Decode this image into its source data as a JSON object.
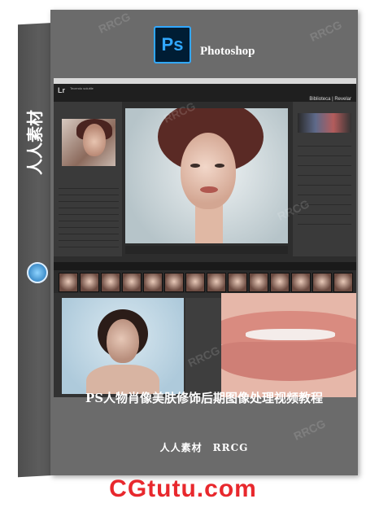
{
  "product": {
    "app_name": "Photoshop",
    "app_icon_text": "Ps",
    "spine_text": "人人素材",
    "title": "PS人物肖像美肤修饰后期图像处理视频教程",
    "brand": "人人素材　RRCG",
    "site": "CGtutu.com"
  },
  "lightroom": {
    "logo": "Lr",
    "catalog": "Tecendo soluttle",
    "modules": "Biblioteca | Revelar"
  },
  "watermark": "RRCG",
  "colors": {
    "box_gray": "#6b6b6b",
    "ps_blue": "#31a8ff",
    "site_red": "#e8282d"
  }
}
